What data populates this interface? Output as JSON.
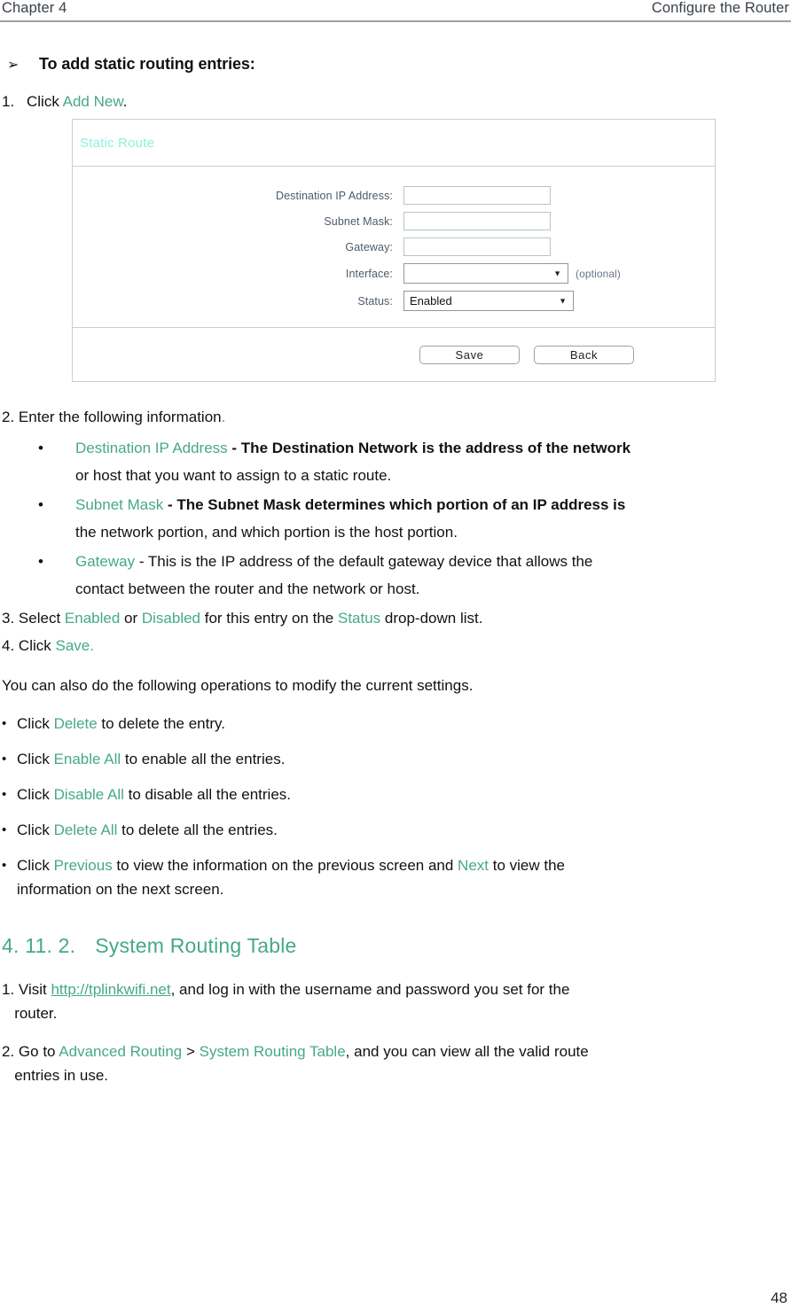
{
  "header": {
    "left": "Chapter 4",
    "right": "Configure the Router"
  },
  "arrow_heading": {
    "glyph": "➢",
    "text": "To add static routing entries:"
  },
  "step1": {
    "num": "1.",
    "prefix": "Click ",
    "link": "Add New",
    "suffix": "."
  },
  "panel": {
    "title": "Static Route",
    "fields": [
      {
        "label": "Destination IP Address:",
        "value": "",
        "type": "text"
      },
      {
        "label": "Subnet Mask:",
        "value": "",
        "type": "text"
      },
      {
        "label": "Gateway:",
        "value": "",
        "type": "text"
      },
      {
        "label": "Interface:",
        "value": "",
        "type": "select",
        "note": "(optional)"
      },
      {
        "label": "Status:",
        "value": "Enabled",
        "type": "select"
      }
    ],
    "caret": "▼",
    "buttons": {
      "save": "Save",
      "back": "Back"
    }
  },
  "step2": {
    "num": "2.",
    "prefix": "Enter the following information",
    "suffix": "."
  },
  "field_bullets": {
    "dot": "•",
    "items": [
      {
        "term": "Destination IP Address",
        "dash": " - ",
        "line1": "The Destination Network is the address of the network",
        "line2": "or host that you want to assign to a static route."
      },
      {
        "term": "Subnet Mask",
        "dash": " - ",
        "line1": "The Subnet Mask determines which portion of an IP address is",
        "line2": "the network portion, and which portion is the host portion."
      },
      {
        "term": "Gateway",
        "dash": " - ",
        "line1": "This is the IP address of the default gateway device that allows the",
        "line2": "contact between the router and the network or host."
      }
    ]
  },
  "step3": {
    "num": "3.",
    "t1": "Select ",
    "enabled": "Enabled",
    "t2": " or ",
    "disabled": "Disabled",
    "t3": " for this entry on the ",
    "status": "Status",
    "t4": " drop-down list."
  },
  "step4": {
    "num": "4.",
    "t1": "Click ",
    "save": "Save."
  },
  "operations_intro": "You can also do the following operations to modify the current settings.",
  "operations": {
    "dot": "•",
    "items": [
      {
        "pre": "Click ",
        "link": "Delete",
        "post": " to delete the entry."
      },
      {
        "pre": "Click ",
        "link": "Enable All",
        "post": " to enable all the entries."
      },
      {
        "pre": "Click ",
        "link": "Disable All",
        "post": " to disable all the entries."
      },
      {
        "pre": "Click ",
        "link": "Delete All",
        "post": " to delete all the entries."
      }
    ],
    "last": {
      "pre": "Click ",
      "link1": "Previous",
      "mid": " to view the information on the previous screen and ",
      "link2": "Next",
      "post": " to view the",
      "line2": "information on the next screen."
    }
  },
  "section": {
    "number": "4. 11. 2.",
    "title": "System Routing Table"
  },
  "visit_step": {
    "num": "1.",
    "pre": "Visit ",
    "link": "http://tplinkwifi.net",
    "post": ", and log in with the username and password you set for the",
    "line2": "router."
  },
  "goto_step": {
    "num": "2.",
    "pre": "Go to ",
    "link1": "Advanced Routing",
    "sep": " > ",
    "link2": "System Routing Table",
    "post": ", and you can view all the valid route",
    "line2": "entries in use."
  },
  "page_number": "48"
}
